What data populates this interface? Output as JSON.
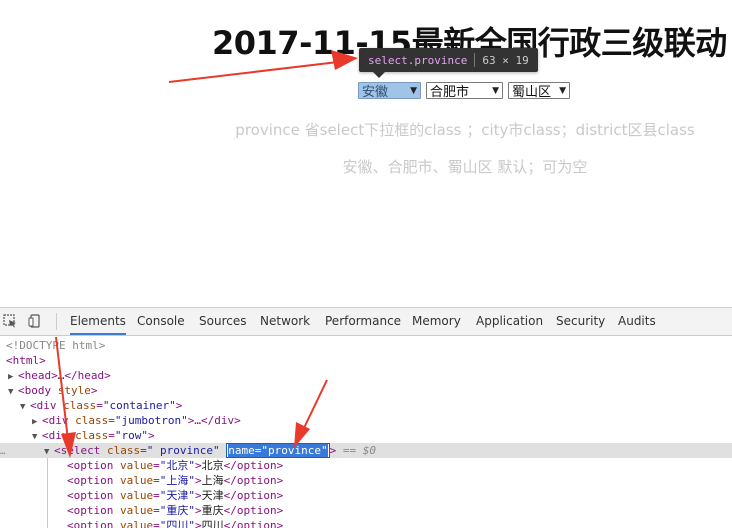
{
  "page": {
    "title": "2017-11-15最新全国行政三级联动",
    "tooltip": {
      "tag": "select",
      "class_suffix": ".province",
      "dims": "63 × 19"
    },
    "selects": {
      "province": "安徽",
      "city": "合肥市",
      "district": "蜀山区"
    },
    "description_1": "province 省select下拉框的class ；city市class；district区县class",
    "description_2": "安徽、合肥市、蜀山区 默认；可为空"
  },
  "devtools": {
    "tabs": [
      "Elements",
      "Console",
      "Sources",
      "Network",
      "Performance",
      "Memory",
      "Application",
      "Security",
      "Audits"
    ],
    "active_tab": "Elements",
    "dom": {
      "doctype": "<!DOCTYPE html>",
      "html_open": "<html>",
      "head": {
        "open": "<head>",
        "ellipsis": "…",
        "close": "</head>"
      },
      "body": {
        "tag": "<body",
        "attr": "style",
        "close": ">"
      },
      "div_container": {
        "tag": "<div",
        "attr_name": "class",
        "attr_value": "\"container\"",
        "close": ">"
      },
      "div_jumbotron": {
        "tag": "<div",
        "attr_name": "class",
        "attr_value": "\"jumbotron\"",
        "close": ">…</div>"
      },
      "div_row": {
        "tag": "<div",
        "attr_name": "class",
        "attr_value": "\"row\"",
        "close": ">"
      },
      "select": {
        "tag": "<select",
        "attr_class_name": "class",
        "attr_class_value": "\" province\"",
        "attr_name_editing": "name=\"province\"",
        "close": ">",
        "eq": "== $0"
      },
      "options": [
        {
          "value": "\"北京\"",
          "text": "北京"
        },
        {
          "value": "\"上海\"",
          "text": "上海"
        },
        {
          "value": "\"天津\"",
          "text": "天津"
        },
        {
          "value": "\"重庆\"",
          "text": "重庆"
        },
        {
          "value": "\"四川\"",
          "text": "四川"
        }
      ],
      "option_open": "<option",
      "option_attr": "value",
      "option_close_tag": "</option>"
    }
  },
  "colors": {
    "arrow": "#e8392b",
    "tag": "#881280",
    "attr_name": "#994500",
    "attr_value": "#1a1aa6",
    "selected_highlight": "#9fc4e7",
    "active_tab_underline": "#3879d9"
  },
  "icons": [
    "inspect-element-icon",
    "device-toggle-icon",
    "select-arrow-icon",
    "expand-triangle-icon",
    "collapse-triangle-icon"
  ]
}
